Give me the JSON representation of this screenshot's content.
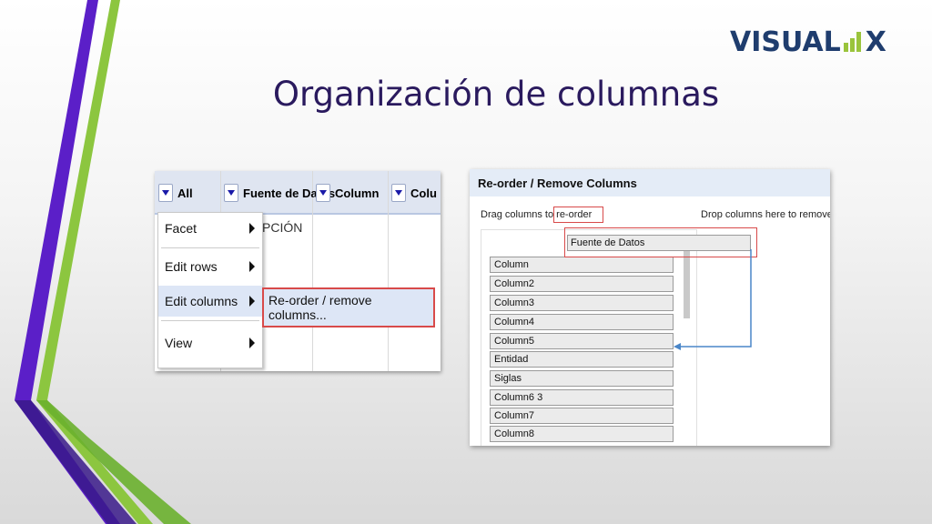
{
  "brand": {
    "logo_left": "VISUAL",
    "logo_right": "X"
  },
  "slide": {
    "title": "Organización de columnas"
  },
  "left_screenshot": {
    "columns": [
      {
        "label": "All"
      },
      {
        "label": "Fuente de Datos"
      },
      {
        "label": "Column"
      },
      {
        "label": "Colu"
      }
    ],
    "cell_text": "PCIÓN",
    "menu": {
      "items": [
        {
          "label": "Facet"
        },
        {
          "label": "Edit rows"
        },
        {
          "label": "Edit columns"
        },
        {
          "label": "View"
        }
      ],
      "submenu_item": "Re-order / remove columns..."
    }
  },
  "right_screenshot": {
    "dialog_title": "Re-order / Remove Columns",
    "drag_label_prefix": "Drag columns to",
    "drag_label_highlight": "re-order",
    "drop_label": "Drop columns here to remove",
    "dragged_column": "Fuente de Datos",
    "columns": [
      "Column",
      "Column2",
      "Column3",
      "Column4",
      "Column5",
      "Entidad",
      "Siglas",
      "Column6 3",
      "Column7",
      "Column8"
    ]
  },
  "colors": {
    "title": "#2a1a5e",
    "accent_purple": "#5b1fc8",
    "accent_green": "#8cc63f",
    "highlight_red": "#d84a4a",
    "arrow_blue": "#4a86c8"
  }
}
